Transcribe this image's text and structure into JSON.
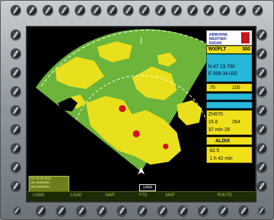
{
  "logo": {
    "text": "AIRBORNE WEATHER RADAR"
  },
  "mode": {
    "left": "WX/FLT",
    "right": "300"
  },
  "position": {
    "lat": "N 47 13.700",
    "lon": "E 008 34.032"
  },
  "rows": [
    {
      "a": "75",
      "b": "100"
    },
    {
      "a": "",
      "b": ""
    },
    {
      "a": "",
      "b": ""
    },
    {
      "a": "ZH070",
      "b": ""
    },
    {
      "a": "15.6",
      "b": "264"
    },
    {
      "a": "37 min 29",
      "b": ""
    },
    {
      "a": "ALDIX",
      "b": ""
    },
    {
      "a": "62.5",
      "b": ""
    },
    {
      "a": "1 h 42 min",
      "b": ""
    }
  ],
  "bottom_labels": [
    "LOAD",
    "LOAD",
    "MAP",
    "FTC",
    "MAP",
    "ROUTE"
  ],
  "info_box": [
    "OL 00.00.0001",
    "SN 00000001",
    "SN 00000001"
  ],
  "range_tag": "10NM",
  "colors": {
    "green": "#6cb43a",
    "yellow": "#e8e01c",
    "red": "#d2141e",
    "cyan": "#27b7d9"
  }
}
